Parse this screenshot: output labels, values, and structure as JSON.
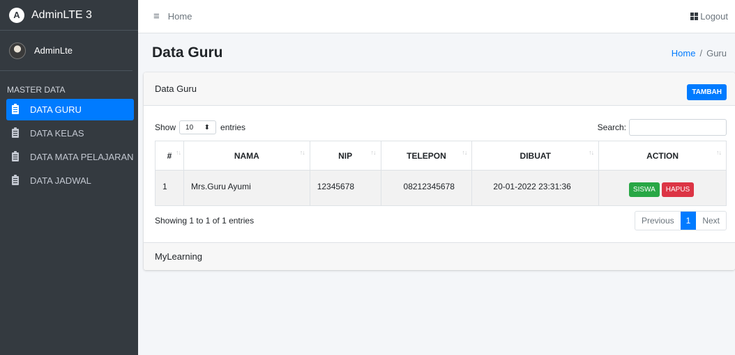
{
  "brand": {
    "name": "AdminLTE 3",
    "logo_letter": "A"
  },
  "user": {
    "name": "AdminLte"
  },
  "sidebar": {
    "header": "MASTER DATA",
    "items": [
      {
        "label": "DATA GURU",
        "active": true
      },
      {
        "label": "DATA KELAS",
        "active": false
      },
      {
        "label": "DATA MATA PELAJARAN",
        "active": false
      },
      {
        "label": "DATA JADWAL",
        "active": false
      }
    ]
  },
  "topbar": {
    "menu_icon": "≡",
    "home_link": "Home",
    "logout_label": "Logout"
  },
  "page": {
    "title": "Data Guru",
    "breadcrumb": [
      "Home",
      "Guru"
    ]
  },
  "card": {
    "title": "Data Guru",
    "add_button": "TAMBAH",
    "footer": "MyLearning"
  },
  "datatable": {
    "show_label": "Show",
    "page_size": "10",
    "entries_label": "entries",
    "search_label": "Search:",
    "search_value": "",
    "columns": [
      "#",
      "NAMA",
      "NIP",
      "TELEPON",
      "DIBUAT",
      "ACTION"
    ],
    "rows": [
      {
        "no": "1",
        "nama": "Mrs.Guru Ayumi",
        "nip": "12345678",
        "telepon": "08212345678",
        "dibuat": "20-01-2022 23:31:36",
        "action_siswa": "SISWA",
        "action_hapus": "HAPUS"
      }
    ],
    "info": "Showing 1 to 1 of 1 entries",
    "pagination": {
      "previous": "Previous",
      "current": "1",
      "next": "Next"
    }
  },
  "colors": {
    "primary": "#007bff",
    "sidebar": "#343a40",
    "success": "#28a745",
    "danger": "#dc3545"
  }
}
